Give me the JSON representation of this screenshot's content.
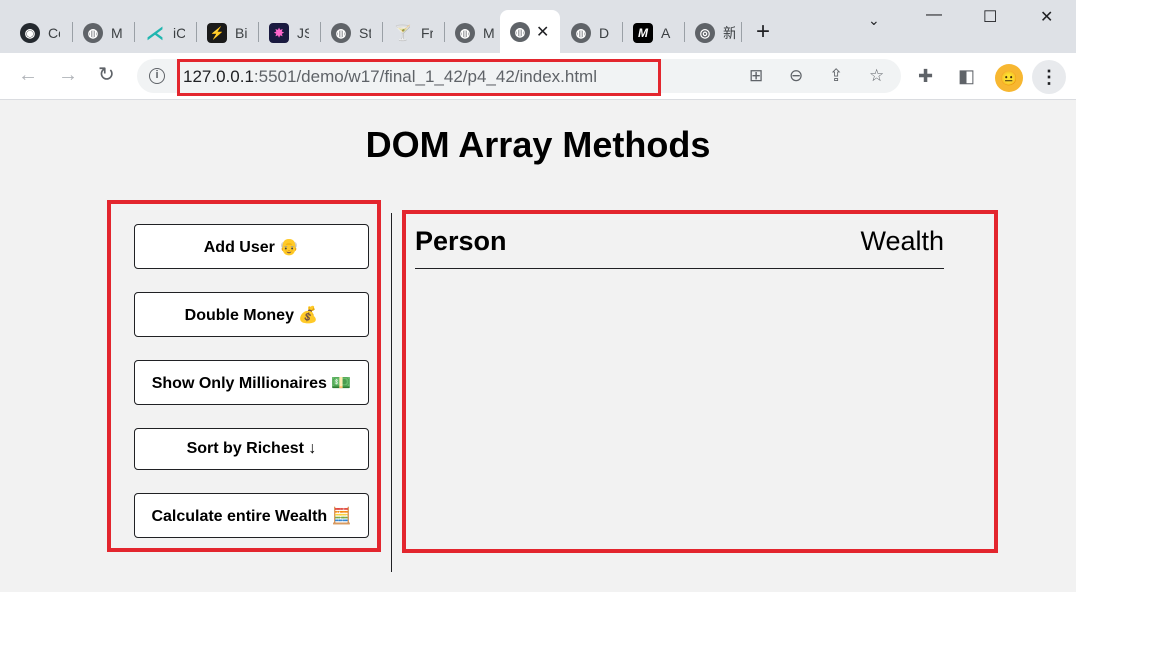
{
  "browser": {
    "tabs": [
      {
        "title": "Co",
        "icon": "github-icon",
        "color": "#24292f",
        "glyph": "◉"
      },
      {
        "title": "M",
        "icon": "globe-icon",
        "color": "#5f6368",
        "glyph": "◍"
      },
      {
        "title": "iC",
        "icon": "icode-icon",
        "color": "#1fb6b0",
        "glyph": "⋌"
      },
      {
        "title": "Bi",
        "icon": "bolt-icon",
        "color": "#1a7f4b",
        "glyph": "⚡"
      },
      {
        "title": "JS",
        "icon": "flower-icon",
        "color": "#6a1b9a",
        "glyph": "✸"
      },
      {
        "title": "St",
        "icon": "globe-icon",
        "color": "#5f6368",
        "glyph": "◍"
      },
      {
        "title": "Fr",
        "icon": "cocktail-icon",
        "color": "#c0392b",
        "glyph": "🍸"
      },
      {
        "title": "M",
        "icon": "globe-icon",
        "color": "#5f6368",
        "glyph": "◍"
      },
      {
        "title": "",
        "icon": "globe-icon",
        "color": "#5f6368",
        "glyph": "◍",
        "active": true
      },
      {
        "title": "D",
        "icon": "globe-icon",
        "color": "#5f6368",
        "glyph": "◍"
      },
      {
        "title": "A",
        "icon": "m-logo-icon",
        "color": "#000000",
        "glyph": "M"
      },
      {
        "title": "新",
        "icon": "chrome-icon",
        "color": "#5f6368",
        "glyph": "◎"
      }
    ],
    "url_host": "127.0.0.1",
    "url_rest": ":5501/demo/w17/final_1_42/p4_42/index.html"
  },
  "page": {
    "title": "DOM Array Methods",
    "buttons": {
      "add_user": "Add User 👴",
      "double_money": "Double Money 💰",
      "show_millionaires": "Show Only Millionaires 💵",
      "sort_richest": "Sort by Richest ↓",
      "calculate_wealth": "Calculate entire Wealth 🧮"
    },
    "table_header": {
      "person": "Person",
      "wealth": "Wealth"
    }
  },
  "colors": {
    "highlight": "#e3262e",
    "page_bg": "#f2f2f2"
  }
}
